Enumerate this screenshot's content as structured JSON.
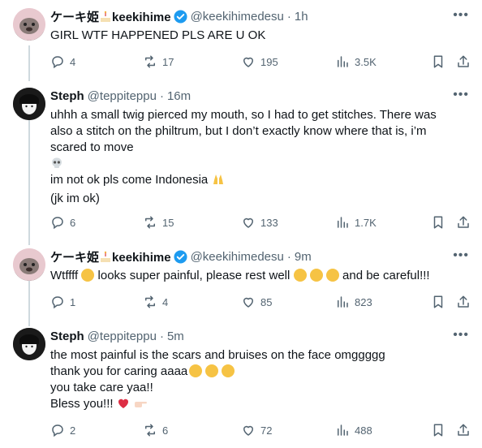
{
  "tweets": [
    {
      "name": "ケーキ姫",
      "name_suffix": "keekihime",
      "handle": "@keekihimedesu",
      "time": "1h",
      "text": [
        "GIRL WTF HAPPENED PLS ARE U OK"
      ],
      "reply_count": "4",
      "retweet_count": "17",
      "like_count": "195",
      "view_count": "3.5K"
    },
    {
      "name": "Steph",
      "handle": "@teppiteppu",
      "time": "16m",
      "text": [
        "uhhh a small twig pierced my mouth, so I had to get stitches. There was",
        "also a stitch on the philtrum, but I don’t exactly know where that is, i’m",
        "scared to move",
        "im not ok pls come Indonesia",
        "(jk im ok)"
      ],
      "reply_count": "6",
      "retweet_count": "15",
      "like_count": "133",
      "view_count": "1.7K"
    },
    {
      "name": "ケーキ姫",
      "name_suffix": "keekihime",
      "handle": "@keekihimedesu",
      "time": "9m",
      "text": [
        "Wtffff",
        "looks super painful, please rest well",
        "and be careful!!!"
      ],
      "reply_count": "1",
      "retweet_count": "4",
      "like_count": "85",
      "view_count": "823"
    },
    {
      "name": "Steph",
      "handle": "@teppiteppu",
      "time": "5m",
      "text": [
        "the most painful is the scars and bruises on the face omggggg",
        "thank you for caring aaaa",
        "you take care yaa!!",
        "Bless you!!!"
      ],
      "reply_count": "2",
      "retweet_count": "6",
      "like_count": "72",
      "view_count": "488"
    }
  ],
  "icons": {
    "reply": "reply-icon",
    "retweet": "retweet-icon",
    "like": "heart-icon",
    "views": "views-icon",
    "bookmark": "bookmark-icon",
    "share": "share-icon",
    "more": "more-icon",
    "verified": "verified-badge-icon"
  },
  "colors": {
    "verified": "#1d9bf0",
    "text": "#0f1419",
    "secondary": "#536471",
    "thread_line": "#cfd9de"
  }
}
